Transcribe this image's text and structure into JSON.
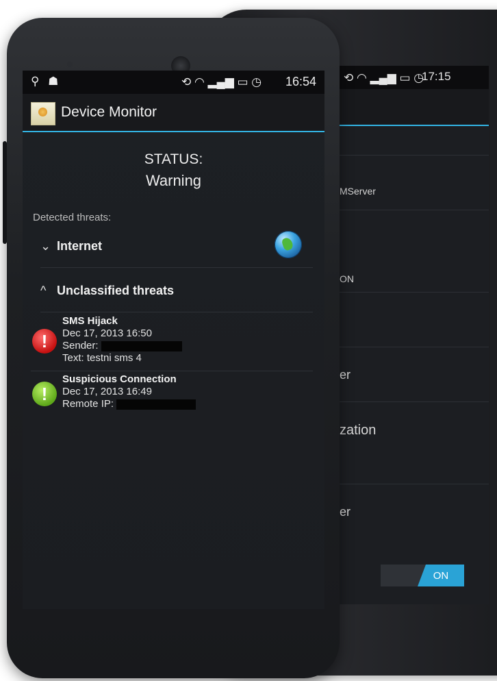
{
  "back_phone": {
    "status_time": "17:15",
    "rows": [
      "MServer",
      "ON",
      "er",
      "zation",
      "er"
    ],
    "toggle_label": "ON"
  },
  "front_phone": {
    "status_time": "16:54",
    "app_title": "Device Monitor",
    "status_label": "STATUS:",
    "status_value": "Warning",
    "detected_label": "Detected threats:",
    "groups": [
      {
        "label": "Internet",
        "chevron": "chevron-down-icon"
      },
      {
        "label": "Unclassified threats",
        "chevron": "chevron-up-icon"
      }
    ],
    "threats": [
      {
        "name": "SMS Hijack",
        "time": "Dec 17, 2013 16:50",
        "detail1": "Sender:",
        "detail2": "Text: testni sms 4",
        "icon": "red-alert-icon"
      },
      {
        "name": "Suspicious Connection",
        "time": "Dec 17, 2013 16:49",
        "detail1": "Remote IP:",
        "icon": "green-alert-icon"
      }
    ]
  },
  "colors": {
    "accent": "#33b5e5",
    "alert_red": "#c51010",
    "alert_green": "#5ea81a"
  }
}
